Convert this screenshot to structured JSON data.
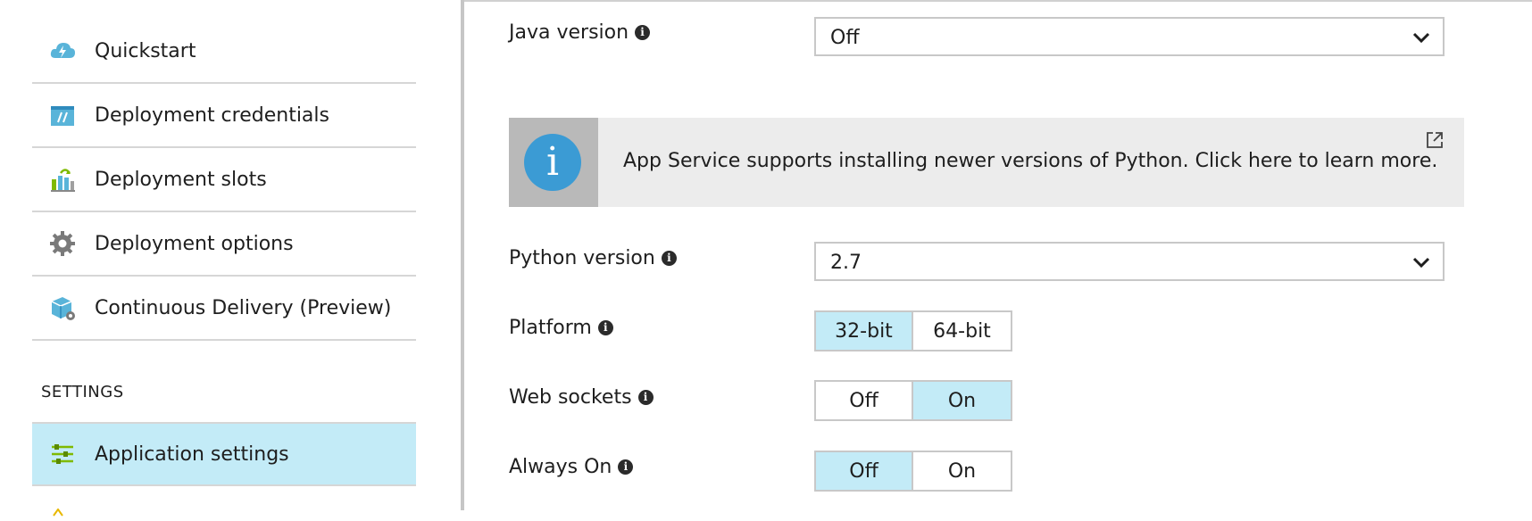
{
  "sidebar": {
    "items": [
      {
        "label": "Quickstart",
        "icon": "cloud-lightning-icon"
      },
      {
        "label": "Deployment credentials",
        "icon": "credentials-icon"
      },
      {
        "label": "Deployment slots",
        "icon": "slots-icon"
      },
      {
        "label": "Deployment options",
        "icon": "gear-icon"
      },
      {
        "label": "Continuous Delivery (Preview)",
        "icon": "package-icon"
      }
    ],
    "section_title": "SETTINGS",
    "settings_items": [
      {
        "label": "Application settings",
        "icon": "sliders-icon",
        "active": true
      }
    ]
  },
  "main": {
    "java": {
      "label": "Java version",
      "value": "Off"
    },
    "banner": {
      "text": "App Service supports installing newer versions of Python. Click here to learn more."
    },
    "python": {
      "label": "Python version",
      "value": "2.7"
    },
    "platform": {
      "label": "Platform",
      "options": [
        "32-bit",
        "64-bit"
      ],
      "selected": "32-bit"
    },
    "web_sockets": {
      "label": "Web sockets",
      "options": [
        "Off",
        "On"
      ],
      "selected": "On"
    },
    "always_on": {
      "label": "Always On",
      "options": [
        "Off",
        "On"
      ],
      "selected": "Off"
    }
  },
  "colors": {
    "accent_selected": "#c3ebf7",
    "info_blue": "#3b9bd4"
  }
}
